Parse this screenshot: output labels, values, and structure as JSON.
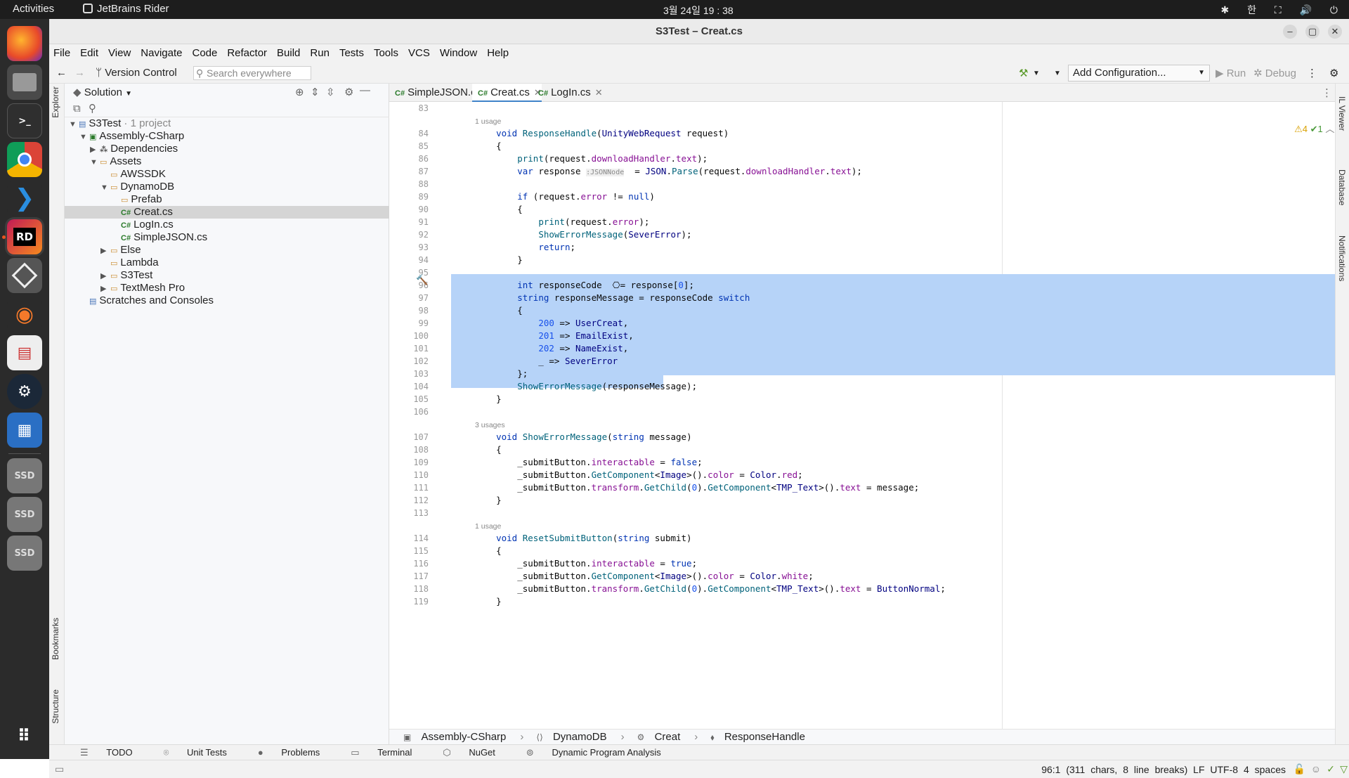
{
  "topbar": {
    "activities": "Activities",
    "app_name": "JetBrains Rider",
    "clock": "3월 24일 19 : 38",
    "ime": "한"
  },
  "dock": {
    "items": [
      "firefox-icon",
      "files-icon",
      "terminal-icon",
      "chrome-icon",
      "vscode-icon",
      "rider-icon",
      "unity-icon",
      "blender-icon",
      "document-viewer-icon",
      "steam-icon",
      "libreoffice-writer-icon",
      "ssd-drive-icon",
      "ssd-drive-icon",
      "ssd-drive-icon",
      "show-apps-icon"
    ],
    "rider_label": "RD",
    "ssd_label": "SSD"
  },
  "window": {
    "title": "S3Test – Creat.cs",
    "minimize": "–",
    "maximize": "▢",
    "close": "✕"
  },
  "menu": [
    "File",
    "Edit",
    "View",
    "Navigate",
    "Code",
    "Refactor",
    "Build",
    "Run",
    "Tests",
    "Tools",
    "VCS",
    "Window",
    "Help"
  ],
  "toolbar": {
    "version_control": "Version Control",
    "search_placeholder": "Search everywhere",
    "add_configuration": "Add Configuration...",
    "run": "Run",
    "debug": "Debug"
  },
  "left_stripe": {
    "explorer": "Explorer",
    "bookmarks": "Bookmarks",
    "structure": "Structure"
  },
  "right_stripe": {
    "il_viewer": "IL Viewer",
    "database": "Database",
    "notifications": "Notifications"
  },
  "explorer": {
    "header": "Solution",
    "tree": [
      {
        "label": "S3Test",
        "suffix": " · 1 project",
        "icon": "solution-icon",
        "depth": 0,
        "arrow": "▼"
      },
      {
        "label": "Assembly-CSharp",
        "icon": "csharp-project-icon",
        "depth": 1,
        "arrow": "▼"
      },
      {
        "label": "Dependencies",
        "icon": "dependencies-icon",
        "depth": 2,
        "arrow": "▶"
      },
      {
        "label": "Assets",
        "icon": "folder-icon",
        "depth": 2,
        "arrow": "▼"
      },
      {
        "label": "AWSSDK",
        "icon": "folder-icon",
        "depth": 3,
        "arrow": ""
      },
      {
        "label": "DynamoDB",
        "icon": "folder-icon",
        "depth": 3,
        "arrow": "▼"
      },
      {
        "label": "Prefab",
        "icon": "folder-icon",
        "depth": 4,
        "arrow": ""
      },
      {
        "label": "Creat.cs",
        "icon": "csharp-file-icon",
        "depth": 4,
        "arrow": "",
        "selected": true
      },
      {
        "label": "LogIn.cs",
        "icon": "csharp-file-icon",
        "depth": 4,
        "arrow": ""
      },
      {
        "label": "SimpleJSON.cs",
        "icon": "csharp-file-icon",
        "depth": 4,
        "arrow": ""
      },
      {
        "label": "Else",
        "icon": "folder-icon",
        "depth": 3,
        "arrow": "▶"
      },
      {
        "label": "Lambda",
        "icon": "folder-icon",
        "depth": 3,
        "arrow": ""
      },
      {
        "label": "S3Test",
        "icon": "folder-icon",
        "depth": 3,
        "arrow": "▶"
      },
      {
        "label": "TextMesh Pro",
        "icon": "folder-icon",
        "depth": 3,
        "arrow": "▶"
      },
      {
        "label": "Scratches and Consoles",
        "icon": "scratches-icon",
        "depth": 1,
        "arrow": ""
      }
    ]
  },
  "tabs": [
    {
      "label": "SimpleJSON.cs"
    },
    {
      "label": "Creat.cs",
      "active": true
    },
    {
      "label": "LogIn.cs"
    }
  ],
  "inspection": {
    "warnings": "4",
    "ok": "1"
  },
  "code": {
    "lines": [
      {
        "n": "83",
        "t": ""
      },
      {
        "hint": "1 usage"
      },
      {
        "n": "84",
        "t": "    void ResponseHandle(UnityWebRequest request)"
      },
      {
        "n": "85",
        "t": "    {"
      },
      {
        "n": "86",
        "t": "        print(request.downloadHandler.text);"
      },
      {
        "n": "87",
        "t": "        var response :JSONNode  = JSON.Parse(request.downloadHandler.text);"
      },
      {
        "n": "88",
        "t": ""
      },
      {
        "n": "89",
        "t": "        if (request.error != null)"
      },
      {
        "n": "90",
        "t": "        {"
      },
      {
        "n": "91",
        "t": "            print(request.error);"
      },
      {
        "n": "92",
        "t": "            ShowErrorMessage(SeverError);"
      },
      {
        "n": "93",
        "t": "            return;"
      },
      {
        "n": "94",
        "t": "        }"
      },
      {
        "n": "95",
        "t": ""
      },
      {
        "n": "96",
        "t": "        int responseCode  ⎔= response[0];"
      },
      {
        "n": "97",
        "t": "        string responseMessage = responseCode switch"
      },
      {
        "n": "98",
        "t": "        {"
      },
      {
        "n": "99",
        "t": "            200 => UserCreat,"
      },
      {
        "n": "100",
        "t": "            201 => EmailExist,"
      },
      {
        "n": "101",
        "t": "            202 => NameExist,"
      },
      {
        "n": "102",
        "t": "            _ => SeverError"
      },
      {
        "n": "103",
        "t": "        };"
      },
      {
        "n": "104",
        "t": "        ShowErrorMessage(responseMessage);"
      },
      {
        "n": "105",
        "t": "    }"
      },
      {
        "n": "106",
        "t": ""
      },
      {
        "hint": "3 usages"
      },
      {
        "n": "107",
        "t": "    void ShowErrorMessage(string message)"
      },
      {
        "n": "108",
        "t": "    {"
      },
      {
        "n": "109",
        "t": "        _submitButton.interactable = false;"
      },
      {
        "n": "110",
        "t": "        _submitButton.GetComponent<Image>().color = Color.red;"
      },
      {
        "n": "111",
        "t": "        _submitButton.transform.GetChild(0).GetComponent<TMP_Text>().text = message;"
      },
      {
        "n": "112",
        "t": "    }"
      },
      {
        "n": "113",
        "t": ""
      },
      {
        "hint": "1 usage"
      },
      {
        "n": "114",
        "t": "    void ResetSubmitButton(string submit)"
      },
      {
        "n": "115",
        "t": "    {"
      },
      {
        "n": "116",
        "t": "        _submitButton.interactable = true;"
      },
      {
        "n": "117",
        "t": "        _submitButton.GetComponent<Image>().color = Color.white;"
      },
      {
        "n": "118",
        "t": "        _submitButton.transform.GetChild(0).GetComponent<TMP_Text>().text = ButtonNormal;"
      },
      {
        "n": "119",
        "t": "    }"
      }
    ]
  },
  "breadcrumb": [
    "Assembly-CSharp",
    "DynamoDB",
    "Creat",
    "ResponseHandle"
  ],
  "bottom_tabs": [
    "TODO",
    "Unit Tests",
    "Problems",
    "Terminal",
    "NuGet",
    "Dynamic Program Analysis"
  ],
  "status": {
    "position": "96:1 (311 chars, 8 line breaks)",
    "line_ending": "LF",
    "encoding": "UTF-8",
    "indent": "4 spaces"
  },
  "colors": {
    "selection": "#b6d3f8",
    "keyword": "#0033b3",
    "accent": "#4083c9"
  }
}
